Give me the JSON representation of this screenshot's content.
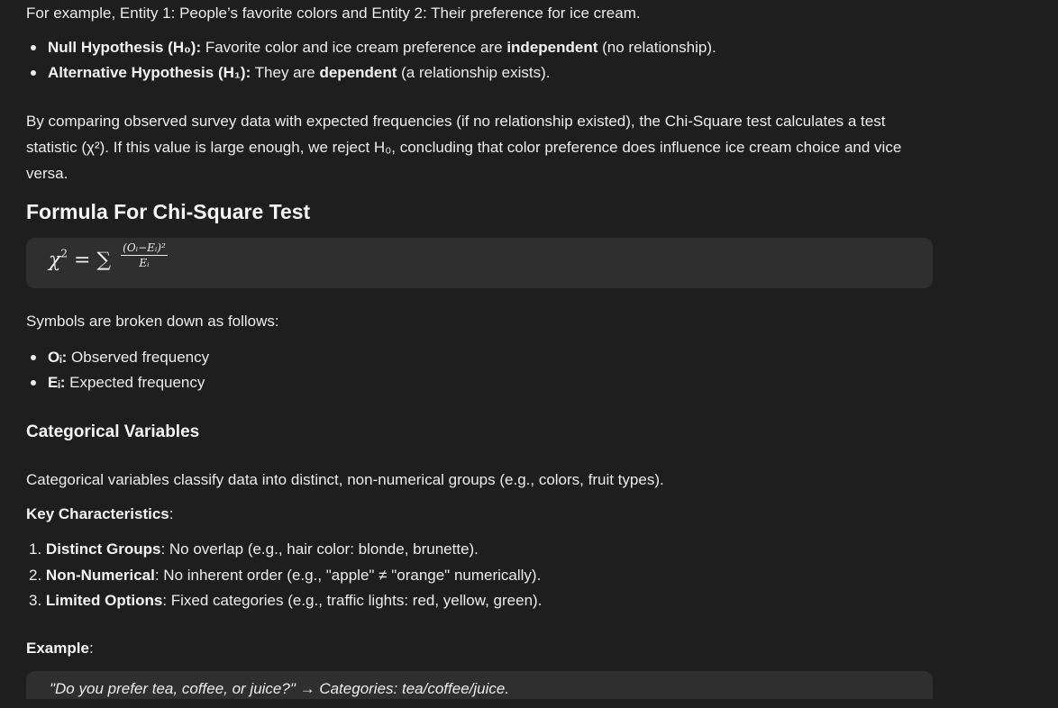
{
  "intro": {
    "text": "For example, Entity 1: People’s favorite colors and Entity 2: Their preference for ice cream."
  },
  "hypotheses": [
    {
      "label": "Null Hypothesis (H₀):",
      "pre": " Favorite color and ice cream preference are ",
      "bold": "independent",
      "post": " (no relationship)."
    },
    {
      "label": "Alternative Hypothesis (H₁):",
      "pre": " They are ",
      "bold": "dependent",
      "post": " (a relationship exists)."
    }
  ],
  "paragraph": "By comparing observed survey data with expected frequencies (if no relationship existed), the Chi-Square test calculates a test statistic (χ²). If this value is large enough, we reject H₀, concluding that color preference does influence ice cream choice and vice versa.",
  "formula_section": {
    "title": "Formula For Chi-Square Test",
    "lhs": "χ",
    "lhs_exp": "2",
    "equals": "=",
    "sum": "∑",
    "numerator": "(Oᵢ−Eᵢ)²",
    "denominator": "Eᵢ"
  },
  "symbols": {
    "intro": "Symbols are broken down as follows:",
    "items": [
      {
        "symbol": "Oᵢ:",
        "desc": " Observed frequency"
      },
      {
        "symbol": "Eᵢ:",
        "desc": " Expected frequency"
      }
    ]
  },
  "categorical": {
    "title": "Categorical Variables",
    "description": "Categorical variables classify data into distinct, non-numerical groups (e.g., colors, fruit types).",
    "key_label": "Key Characteristics",
    "key_colon": ":",
    "traits": [
      {
        "num": "1.",
        "label": "Distinct Groups",
        "desc": ": No overlap (e.g., hair color: blonde, brunette)."
      },
      {
        "num": "2.",
        "label": "Non-Numerical",
        "desc": ": No inherent order (e.g., \"apple\" ≠ \"orange\" numerically)."
      },
      {
        "num": "3.",
        "label": "Limited Options",
        "desc": ": Fixed categories (e.g., traffic lights: red, yellow, green)."
      }
    ],
    "example_label": "Example",
    "example_colon": ":",
    "example_quote": "\"Do you prefer tea, coffee, or juice?\" → Categories: tea/coffee/juice."
  }
}
